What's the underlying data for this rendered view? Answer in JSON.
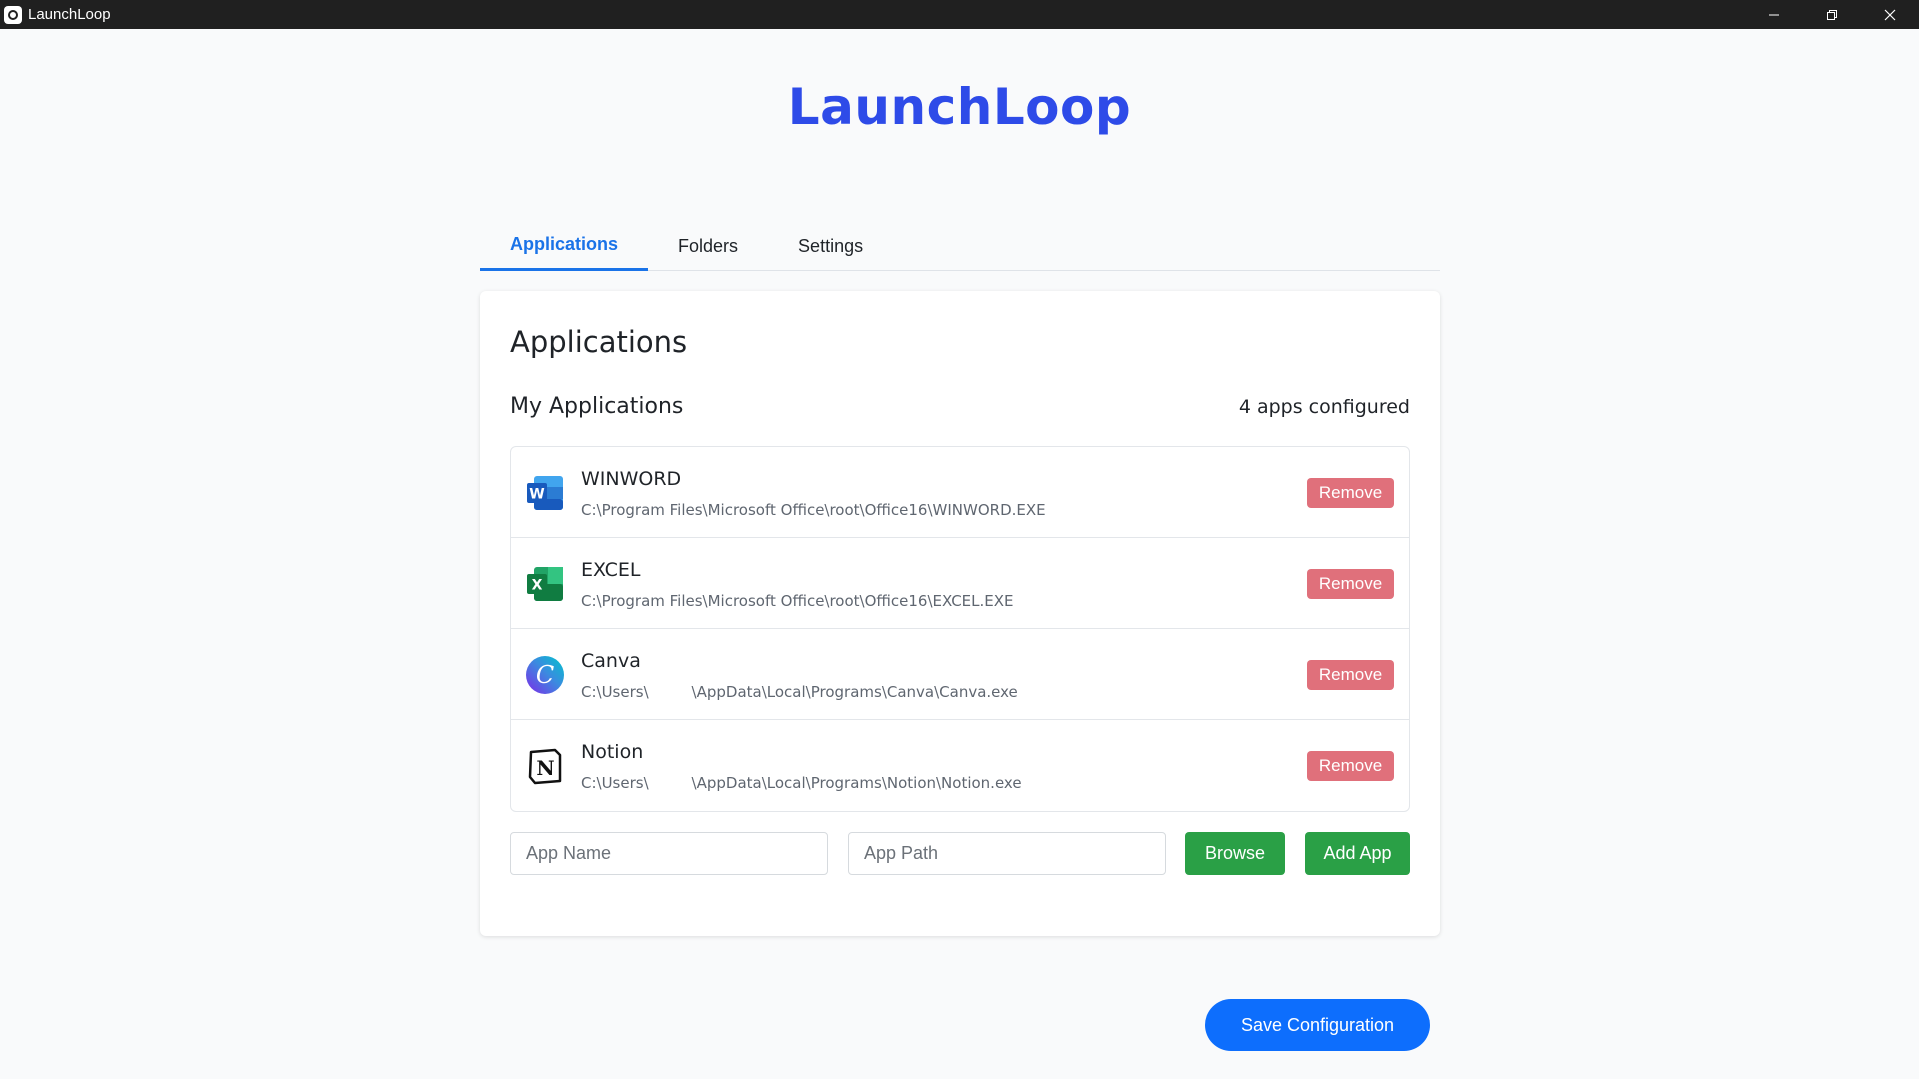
{
  "window": {
    "title": "LaunchLoop"
  },
  "header": {
    "brand": "LaunchLoop"
  },
  "tabs": [
    {
      "label": "Applications",
      "active": true
    },
    {
      "label": "Folders",
      "active": false
    },
    {
      "label": "Settings",
      "active": false
    }
  ],
  "card": {
    "title": "Applications",
    "section_title": "My Applications",
    "count_text": "4 apps configured"
  },
  "apps": [
    {
      "name": "WINWORD",
      "path": "C:\\Program Files\\Microsoft Office\\root\\Office16\\WINWORD.EXE",
      "icon": "word-icon",
      "remove_label": "Remove"
    },
    {
      "name": "EXCEL",
      "path": "C:\\Program Files\\Microsoft Office\\root\\Office16\\EXCEL.EXE",
      "icon": "excel-icon",
      "remove_label": "Remove"
    },
    {
      "name": "Canva",
      "path": "C:\\Users\\         \\AppData\\Local\\Programs\\Canva\\Canva.exe",
      "icon": "canva-icon",
      "remove_label": "Remove"
    },
    {
      "name": "Notion",
      "path": "C:\\Users\\         \\AppData\\Local\\Programs\\Notion\\Notion.exe",
      "icon": "notion-icon",
      "remove_label": "Remove"
    }
  ],
  "add_form": {
    "name_placeholder": "App Name",
    "path_placeholder": "App Path",
    "browse_label": "Browse",
    "add_label": "Add App"
  },
  "footer": {
    "save_label": "Save Configuration"
  },
  "colors": {
    "brand": "#2e4be8",
    "tab_active": "#1a73e8",
    "remove": "#e0707b",
    "green": "#2aa046",
    "save": "#0d6efd"
  }
}
